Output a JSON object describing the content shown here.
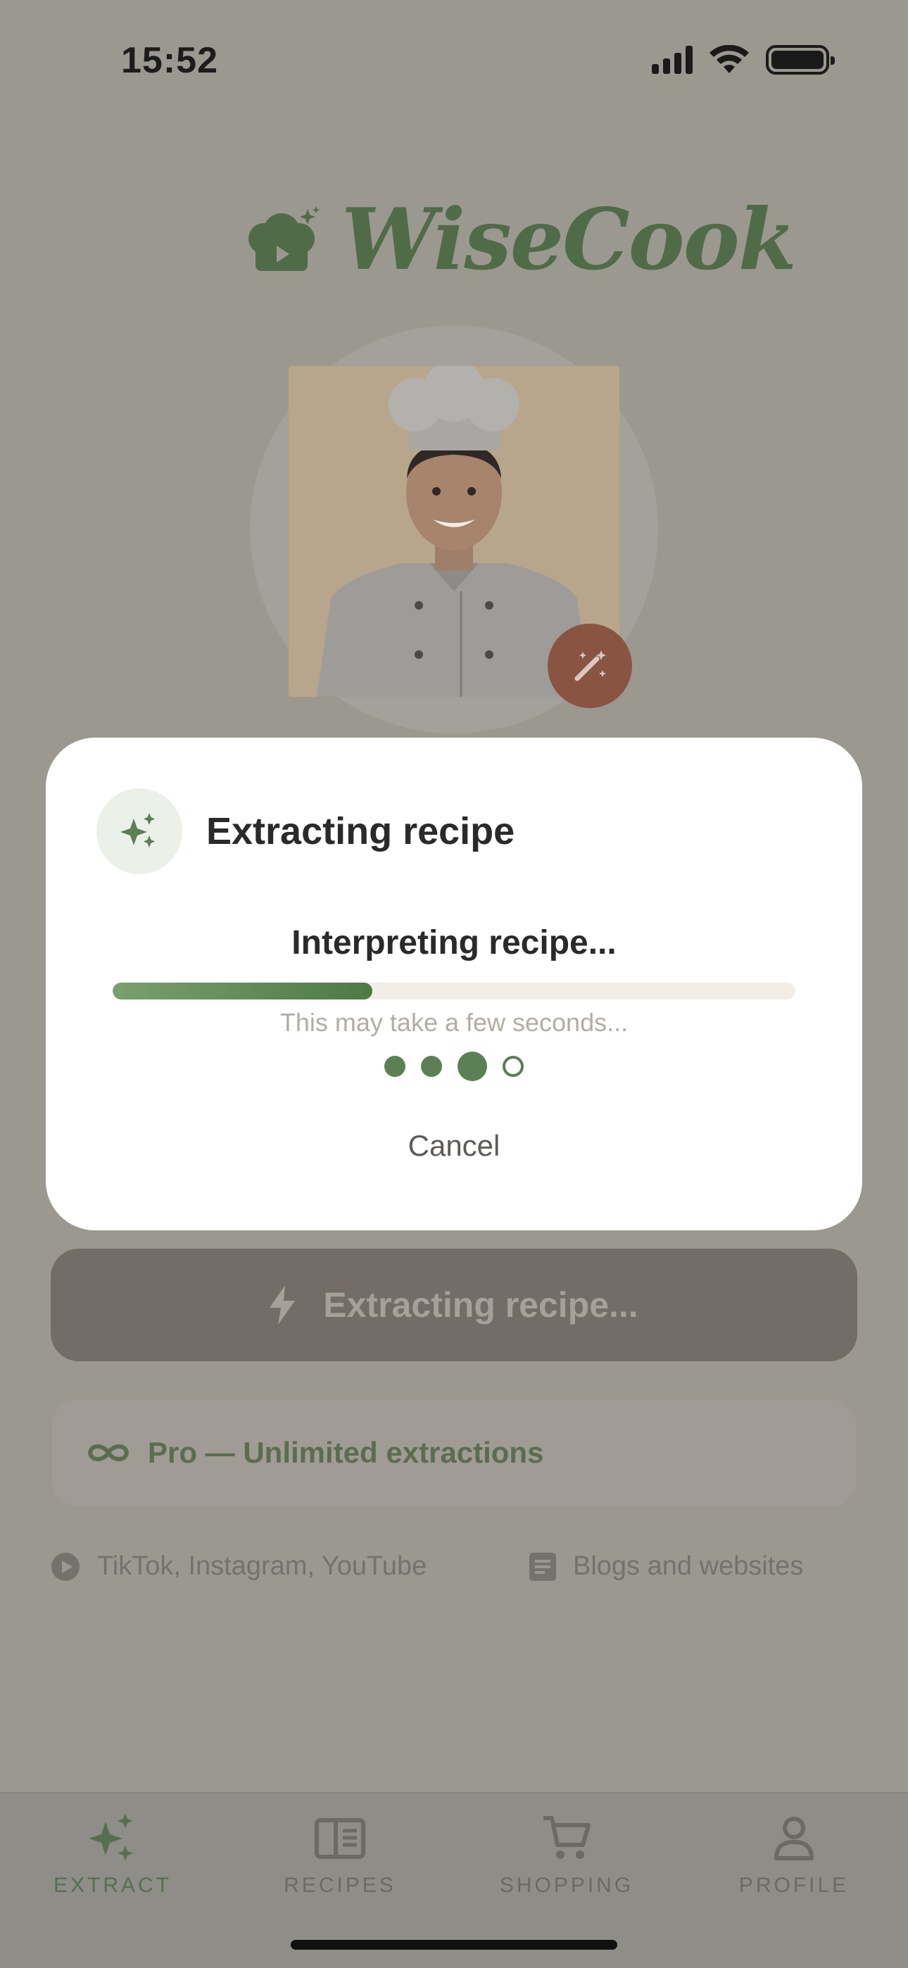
{
  "status_bar": {
    "time": "15:52"
  },
  "app": {
    "name": "WiseCook"
  },
  "modal": {
    "title": "Extracting recipe",
    "status": "Interpreting recipe...",
    "progress": 0.38,
    "hint": "This may take a few seconds...",
    "cancel_label": "Cancel",
    "step_dots": [
      "done",
      "done",
      "current",
      "pending"
    ]
  },
  "main": {
    "extract_button_label": "Extracting recipe...",
    "pro_label": "Pro — Unlimited extractions",
    "sources": [
      {
        "icon": "play-icon",
        "label": "TikTok, Instagram, YouTube"
      },
      {
        "icon": "document-icon",
        "label": "Blogs and websites"
      }
    ]
  },
  "tabs": [
    {
      "label": "EXTRACT",
      "icon": "sparkles-icon",
      "active": true
    },
    {
      "label": "RECIPES",
      "icon": "book-icon",
      "active": false
    },
    {
      "label": "SHOPPING",
      "icon": "cart-icon",
      "active": false
    },
    {
      "label": "PROFILE",
      "icon": "person-icon",
      "active": false
    }
  ],
  "colors": {
    "accent": "#5c7f55",
    "wand_button": "#8a5442",
    "overlay_background": "#9b9890"
  }
}
